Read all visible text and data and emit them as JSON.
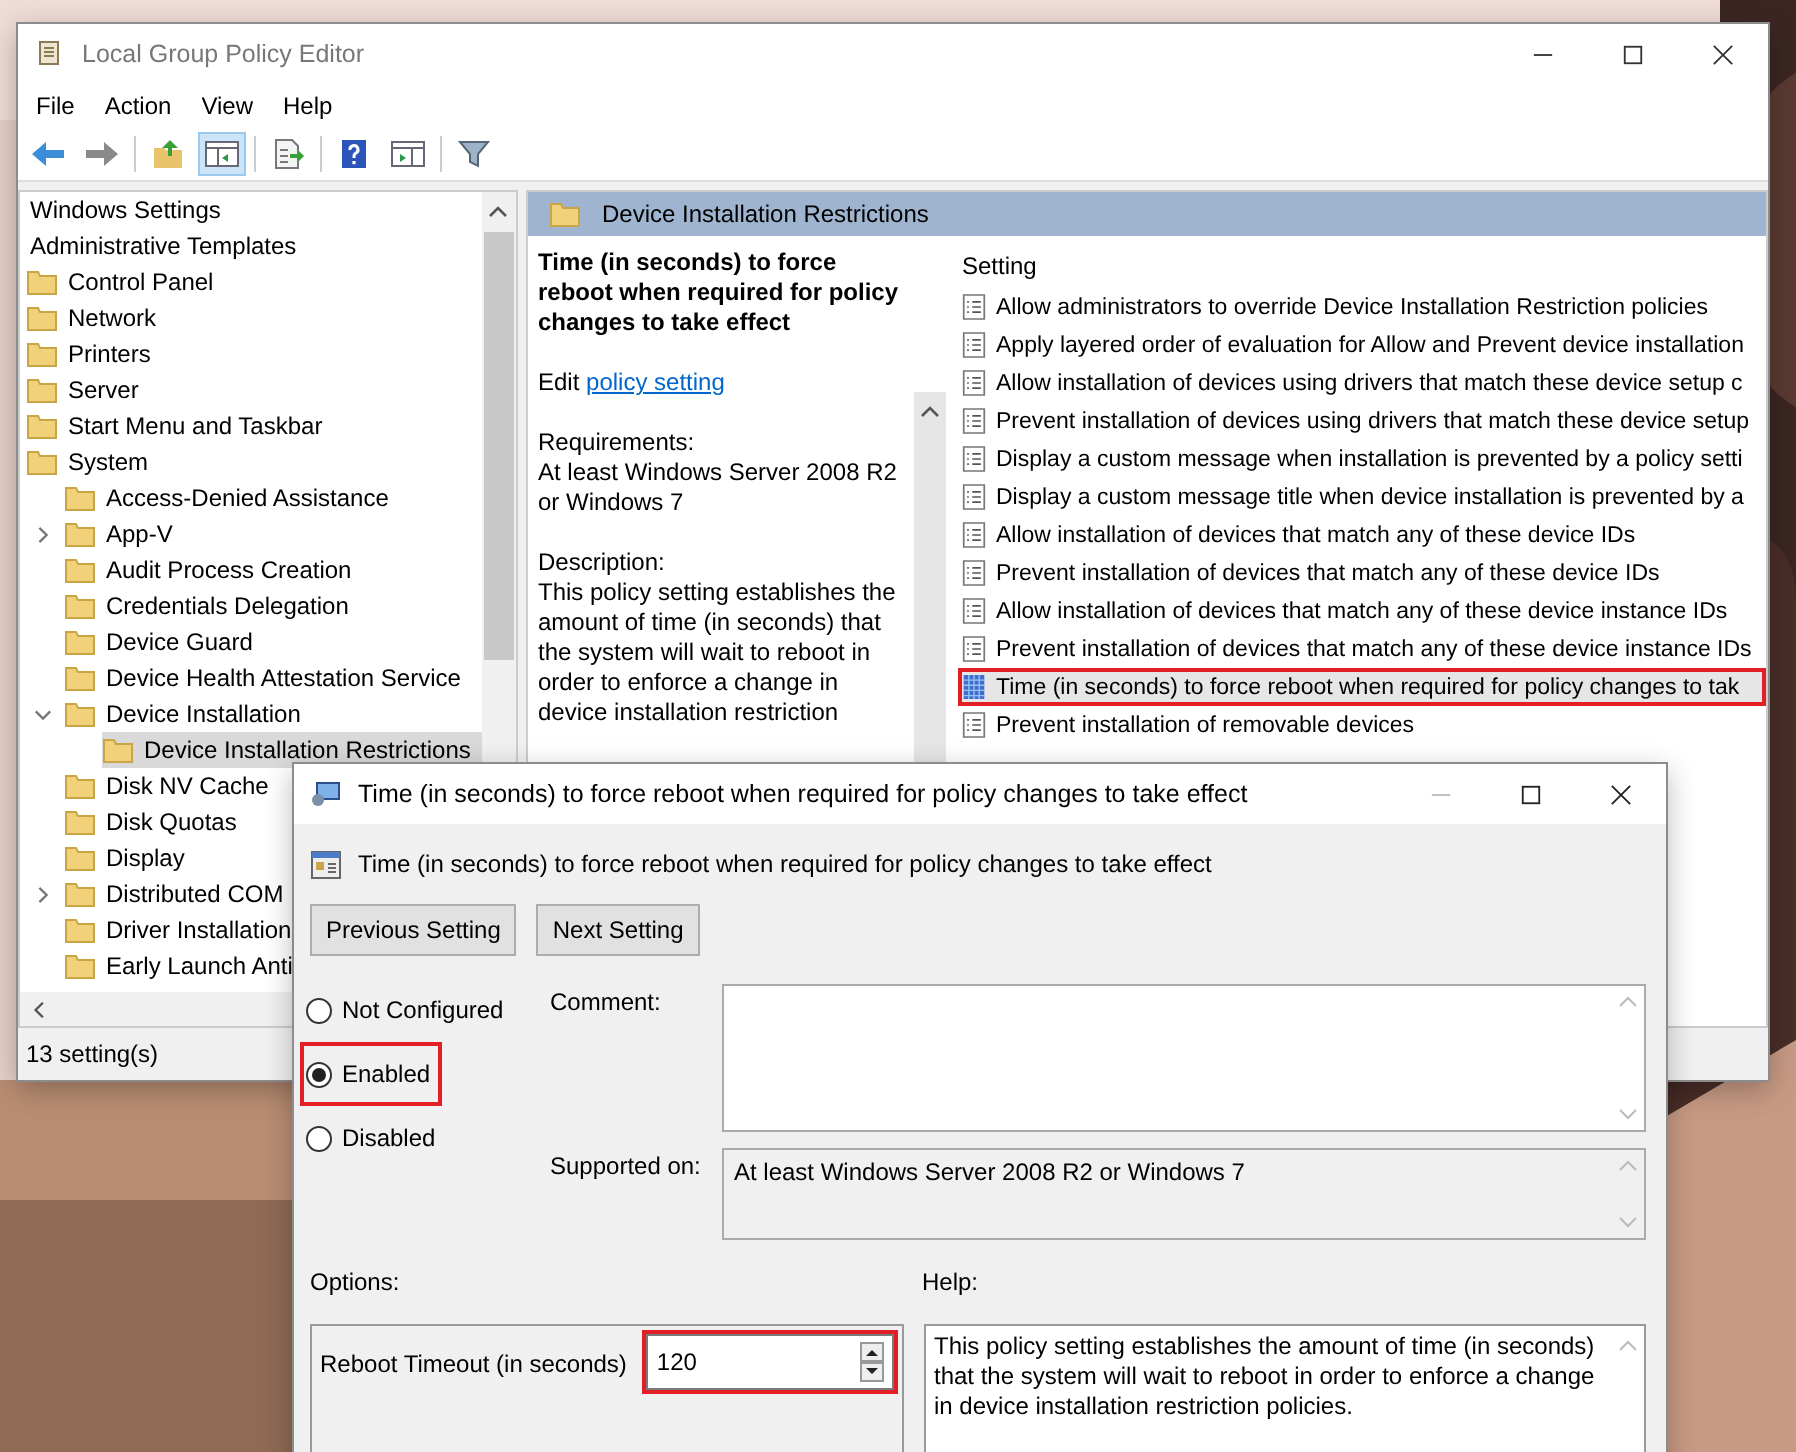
{
  "window": {
    "title": "Local Group Policy Editor"
  },
  "menu": [
    "File",
    "Action",
    "View",
    "Help"
  ],
  "tree": [
    {
      "label": "Windows Settings",
      "selected": false
    },
    {
      "label": "Administrative Templates",
      "selected": false,
      "children": [
        {
          "label": "Control Panel",
          "selected": false
        },
        {
          "label": "Network",
          "selected": false
        },
        {
          "label": "Printers",
          "selected": false
        },
        {
          "label": "Server",
          "selected": false
        },
        {
          "label": "Start Menu and Taskbar",
          "selected": false
        },
        {
          "label": "System",
          "selected": false,
          "children": [
            {
              "label": "Access-Denied Assistance",
              "selected": false
            },
            {
              "label": "App-V",
              "selected": false,
              "expanded": false
            },
            {
              "label": "Audit Process Creation",
              "selected": false
            },
            {
              "label": "Credentials Delegation",
              "selected": false
            },
            {
              "label": "Device Guard",
              "selected": false
            },
            {
              "label": "Device Health Attestation Service",
              "selected": false
            },
            {
              "label": "Device Installation",
              "selected": false,
              "expanded": true,
              "children": [
                {
                  "label": "Device Installation Restrictions",
                  "selected": true
                }
              ]
            },
            {
              "label": "Disk NV Cache",
              "selected": false
            },
            {
              "label": "Disk Quotas",
              "selected": false
            },
            {
              "label": "Display",
              "selected": false
            },
            {
              "label": "Distributed COM",
              "selected": false,
              "expanded": false
            },
            {
              "label": "Driver Installation",
              "selected": false
            },
            {
              "label": "Early Launch Anti",
              "selected": false
            }
          ]
        }
      ]
    }
  ],
  "status_bar": "13 setting(s)",
  "details": {
    "header": "Device Installation Restrictions",
    "policy_title": "Time (in seconds) to force reboot when required for policy changes to take effect",
    "edit_prefix": "Edit",
    "edit_link": "policy setting",
    "requirements_label": "Requirements:",
    "requirements": "At least Windows Server 2008 R2 or Windows 7",
    "description_label": "Description:",
    "description": "This policy setting establishes the amount of time (in seconds) that the system will wait to reboot in order to enforce a change in device installation restriction"
  },
  "settings": {
    "column": "Setting",
    "rows": [
      {
        "name": "Allow administrators to override Device Installation Restriction policies",
        "selected": false
      },
      {
        "name": "Apply layered order of evaluation for Allow and Prevent device installation",
        "selected": false
      },
      {
        "name": "Allow installation of devices using drivers that match these device setup c",
        "selected": false
      },
      {
        "name": "Prevent installation of devices using drivers that match these device setup",
        "selected": false
      },
      {
        "name": "Display a custom message when installation is prevented by a policy setti",
        "selected": false
      },
      {
        "name": "Display a custom message title when device installation is prevented by a",
        "selected": false
      },
      {
        "name": "Allow installation of devices that match any of these device IDs",
        "selected": false
      },
      {
        "name": "Prevent installation of devices that match any of these device IDs",
        "selected": false
      },
      {
        "name": "Allow installation of devices that match any of these device instance IDs",
        "selected": false
      },
      {
        "name": "Prevent installation of devices that match any of these device instance IDs",
        "selected": false
      },
      {
        "name": "Time (in seconds) to force reboot when required for policy changes to tak",
        "selected": true
      },
      {
        "name": "Prevent installation of removable devices",
        "selected": false
      }
    ]
  },
  "dialog": {
    "title": "Time (in seconds) to force reboot when required for policy changes to take effect",
    "heading": "Time (in seconds) to force reboot when required for policy changes to take effect",
    "buttons": [
      "Previous Setting",
      "Next Setting"
    ],
    "options": [
      {
        "label": "Not Configured",
        "selected": false,
        "highlighted": false
      },
      {
        "label": "Enabled",
        "selected": true,
        "highlighted": true
      },
      {
        "label": "Disabled",
        "selected": false,
        "highlighted": false
      }
    ],
    "comment_label": "Comment:",
    "supported_label": "Supported on:",
    "supported": "At least Windows Server 2008 R2 or Windows 7",
    "options_label": "Options:",
    "help_label": "Help:",
    "timeout": {
      "label": "Reboot Timeout (in seconds)",
      "value": "120",
      "highlighted": true
    },
    "help": "This policy setting establishes the amount of time (in seconds) that the system will wait to reboot in order to enforce a change in device installation restriction policies."
  }
}
